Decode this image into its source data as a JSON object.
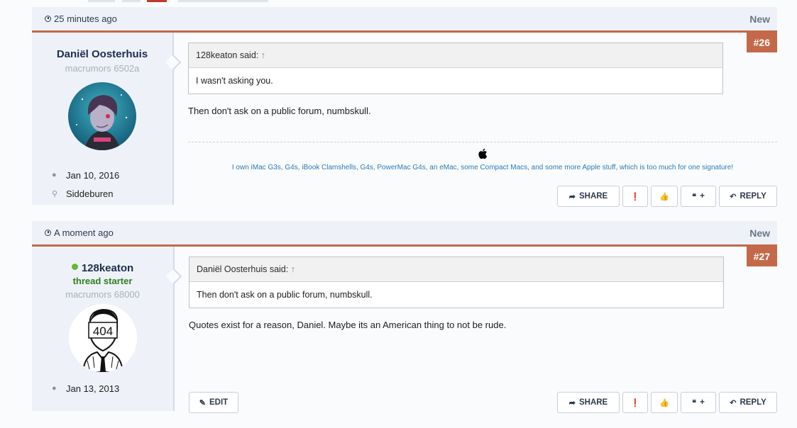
{
  "posts": [
    {
      "time": "25 minutes ago",
      "status": "New",
      "number": "#26",
      "username": "Daniël Oosterhuis",
      "user_title": "macrumors 6502a",
      "joined": "Jan 10, 2016",
      "location": "Siddeburen",
      "quote_author": "128keaton said:",
      "quote_arrow": "↑",
      "quote_text": "I wasn't asking you.",
      "message": "Then don't ask on a public forum, numbskull.",
      "signature": "I own iMac G3s, G4s, iBook Clamshells, G4s, PowerMac G4s, an eMac, some Compact Macs, and some more Apple stuff, which is too much for one signature!"
    },
    {
      "time": "A moment ago",
      "status": "New",
      "number": "#27",
      "username": "128keaton",
      "starter": "thread starter",
      "user_title": "macrumors 68000",
      "joined": "Jan 13, 2013",
      "quote_author": "Daniël Oosterhuis said:",
      "quote_arrow": "↑",
      "quote_text": "Then don't ask on a public forum, numbskull.",
      "message": "Quotes exist for a reason, Daniel. Maybe its an American thing to not be rude.",
      "avatar_text": "404"
    }
  ],
  "buttons": {
    "share": "SHARE",
    "reply": "REPLY",
    "edit": "EDIT",
    "quote_plus": "+"
  },
  "icons": {
    "share": "share-arrow-icon",
    "report": "exclamation-icon",
    "like": "thumbs-up-icon",
    "quote": "quote-icon",
    "reply": "reply-arrow-icon",
    "edit": "pencil-icon",
    "clock": "clock-icon",
    "user": "user-icon",
    "location": "map-pin-icon",
    "apple": "apple-logo-icon"
  },
  "colors": {
    "accent": "#c36949",
    "header_bg": "#eef2f8",
    "online": "#63b935",
    "link": "#2c7bb8"
  }
}
